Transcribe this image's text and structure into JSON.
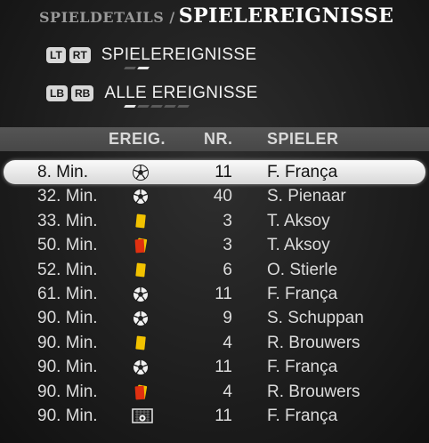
{
  "header": {
    "breadcrumb": "SPIELDETAILS /",
    "title": "SPIELEREIGNISSE"
  },
  "controls": [
    {
      "buttons": [
        "LT",
        "RT"
      ],
      "label": "SPIELEREIGNISSE"
    },
    {
      "buttons": [
        "LB",
        "RB"
      ],
      "label": "ALLE EREIGNISSE"
    }
  ],
  "columns": {
    "event": "EREIG.",
    "number": "NR.",
    "player": "SPIELER"
  },
  "events": [
    {
      "time": "8. Min.",
      "icon": "goal-ball-icon",
      "nr": "11",
      "player": "F. França"
    },
    {
      "time": "32. Min.",
      "icon": "goal-ball-icon",
      "nr": "40",
      "player": "S. Pienaar"
    },
    {
      "time": "33. Min.",
      "icon": "yellow-card-icon",
      "nr": "3",
      "player": "T. Aksoy"
    },
    {
      "time": "50. Min.",
      "icon": "red-card-icon",
      "nr": "3",
      "player": "T. Aksoy"
    },
    {
      "time": "52. Min.",
      "icon": "yellow-card-icon",
      "nr": "6",
      "player": "O. Stierle"
    },
    {
      "time": "61. Min.",
      "icon": "goal-ball-icon",
      "nr": "11",
      "player": "F. França"
    },
    {
      "time": "90. Min.",
      "icon": "goal-ball-icon",
      "nr": "9",
      "player": "S. Schuppan"
    },
    {
      "time": "90. Min.",
      "icon": "yellow-card-icon",
      "nr": "4",
      "player": "R. Brouwers"
    },
    {
      "time": "90. Min.",
      "icon": "goal-ball-icon",
      "nr": "11",
      "player": "F. França"
    },
    {
      "time": "90. Min.",
      "icon": "red-card-icon",
      "nr": "4",
      "player": "R. Brouwers"
    },
    {
      "time": "90. Min.",
      "icon": "penalty-goal-icon",
      "nr": "11",
      "player": "F. França"
    }
  ],
  "colors": {
    "yellow_card": "#f2c200",
    "red_card": "#e03010",
    "selected_row": "#f4f4f4"
  }
}
